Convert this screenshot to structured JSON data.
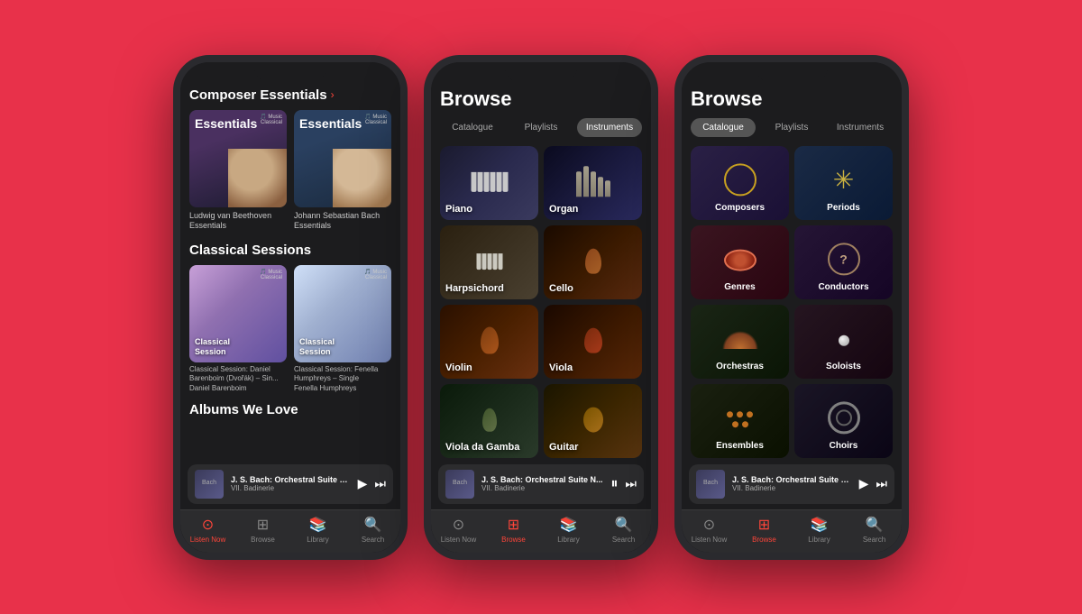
{
  "background_color": "#e8314a",
  "phones": [
    {
      "id": "phone1",
      "type": "listen_now",
      "sections": [
        {
          "title": "Composer Essentials",
          "has_arrow": true,
          "albums": [
            {
              "title": "Essentials",
              "subtitle": "Ludwig van Beethoven Essentials",
              "style": "beethoven"
            },
            {
              "title": "Essentials",
              "subtitle": "Johann Sebastian Bach Essentials",
              "style": "bach"
            }
          ]
        },
        {
          "title": "Classical Sessions",
          "albums": [
            {
              "title": "Classical Session",
              "subtitle": "Classical Session: Daniel Barenboim (Dvořák) – Sin...",
              "artist": "Daniel Barenboim",
              "style": "session1"
            },
            {
              "title": "Classical Session",
              "subtitle": "Classical Session: Fenella Humphreys – Single",
              "artist": "Fenella Humphreys",
              "style": "session2"
            }
          ]
        },
        {
          "title": "Albums We Love"
        }
      ],
      "now_playing": {
        "title": "J. S. Bach: Orchestral Suite N...",
        "subtitle": "VII. Badinerie",
        "thumb_text": "Bach"
      },
      "nav": {
        "active": "listen_now",
        "items": [
          "Listen Now",
          "Browse",
          "Library",
          "Search"
        ]
      }
    },
    {
      "id": "phone2",
      "type": "browse_instruments",
      "title": "Browse",
      "tabs": [
        "Catalogue",
        "Playlists",
        "Instruments"
      ],
      "active_tab": "Instruments",
      "instruments": [
        {
          "name": "Piano",
          "style": "piano"
        },
        {
          "name": "Organ",
          "style": "organ"
        },
        {
          "name": "Harpsichord",
          "style": "harp"
        },
        {
          "name": "Cello",
          "style": "cello"
        },
        {
          "name": "Violin",
          "style": "violin"
        },
        {
          "name": "Viola",
          "style": "viola"
        },
        {
          "name": "Viola da Gamba",
          "style": "viol"
        },
        {
          "name": "Guitar",
          "style": "guitar"
        }
      ],
      "now_playing": {
        "title": "J. S. Bach: Orchestral Suite N...",
        "subtitle": "VII. Badinerie",
        "thumb_text": "Bach"
      },
      "nav": {
        "active": "browse",
        "items": [
          "Listen Now",
          "Browse",
          "Library",
          "Search"
        ]
      }
    },
    {
      "id": "phone3",
      "type": "browse_catalogue",
      "title": "Browse",
      "tabs": [
        "Catalogue",
        "Playlists",
        "Instruments"
      ],
      "active_tab": "Catalogue",
      "categories": [
        {
          "name": "Composers",
          "style": "composers",
          "icon": "circle"
        },
        {
          "name": "Periods",
          "style": "periods",
          "icon": "asterisk"
        },
        {
          "name": "Genres",
          "style": "genres",
          "icon": "drum"
        },
        {
          "name": "Conductors",
          "style": "conductors",
          "icon": "question"
        },
        {
          "name": "Orchestras",
          "style": "orchestras",
          "icon": "fan"
        },
        {
          "name": "Soloists",
          "style": "soloists",
          "icon": "pearl"
        },
        {
          "name": "Ensembles",
          "style": "ensembles",
          "icon": "dots"
        },
        {
          "name": "Choirs",
          "style": "choirs",
          "icon": "spiral"
        }
      ],
      "now_playing": {
        "title": "J. S. Bach: Orchestral Suite N...",
        "subtitle": "VII. Badinerie",
        "thumb_text": "Bach"
      },
      "nav": {
        "active": "browse",
        "items": [
          "Listen Now",
          "Browse",
          "Library",
          "Search"
        ]
      }
    }
  ]
}
